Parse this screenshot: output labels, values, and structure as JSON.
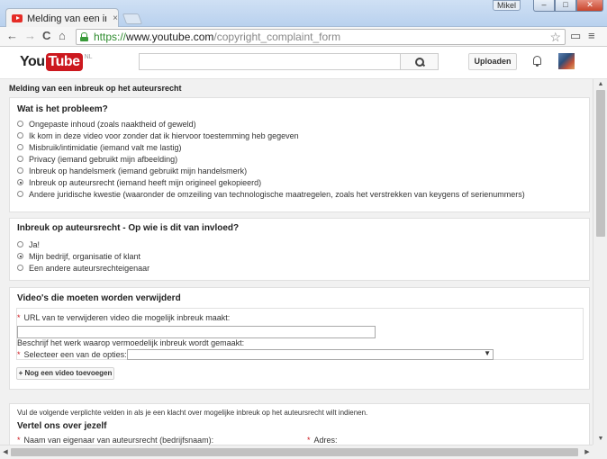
{
  "window": {
    "tab_title": "Melding van een inbreuk o",
    "tab_close": "×",
    "profile_name": "Mikel",
    "min_glyph": "–",
    "max_glyph": "□",
    "close_glyph": "✕"
  },
  "toolbar": {
    "back": "←",
    "forward": "→",
    "reload": "C",
    "home": "⌂",
    "url_scheme": "https://",
    "url_host": "www.youtube.com",
    "url_path": "/copyright_complaint_form",
    "star": "☆",
    "cast": "▭",
    "menu": "≡"
  },
  "yt_header": {
    "logo_you": "You",
    "logo_tube": "Tube",
    "logo_country": "NL",
    "search_value": "",
    "upload_label": "Uploaden"
  },
  "page": {
    "title": "Melding van een inbreuk op het auteursrecht"
  },
  "problem_card": {
    "title": "Wat is het probleem?",
    "options": [
      {
        "label": "Ongepaste inhoud (zoals naaktheid of geweld)",
        "checked": false
      },
      {
        "label": "Ik kom in deze video voor zonder dat ik hiervoor toestemming heb gegeven",
        "checked": false
      },
      {
        "label": "Misbruik/intimidatie (iemand valt me lastig)",
        "checked": false
      },
      {
        "label": "Privacy (iemand gebruikt mijn afbeelding)",
        "checked": false
      },
      {
        "label": "Inbreuk op handelsmerk (iemand gebruikt mijn handelsmerk)",
        "checked": false
      },
      {
        "label": "Inbreuk op auteursrecht (iemand heeft mijn origineel gekopieerd)",
        "checked": true
      },
      {
        "label": "Andere juridische kwestie (waaronder de omzeiling van technologische maatregelen, zoals het verstrekken van keygens of serienummers)",
        "checked": false
      }
    ]
  },
  "affected_card": {
    "title": "Inbreuk op auteursrecht - Op wie is dit van invloed?",
    "options": [
      {
        "label": "Ja!",
        "checked": false
      },
      {
        "label": "Mijn bedrijf, organisatie of klant",
        "checked": true
      },
      {
        "label": "Een andere auteursrechteigenaar",
        "checked": false
      }
    ]
  },
  "videos_card": {
    "title": "Video's die moeten worden verwijderd",
    "required_mark": "*",
    "url_label": "URL van te verwijderen video die mogelijk inbreuk maakt:",
    "url_value": "",
    "describe_label": "Beschrijf het werk waarop vermoedelijk inbreuk wordt gemaakt:",
    "select_label": "Selecteer een van de opties:",
    "select_value": "",
    "select_arrow": "▼",
    "add_video_label": "+ Nog een video toevoegen"
  },
  "about_card": {
    "note": "Vul de volgende verplichte velden in als je een klacht over mogelijke inbreuk op het auteursrecht wilt indienen.",
    "title": "Vertel ons over jezelf",
    "owner_label": "Naam van eigenaar van auteursrecht (bedrijfsnaam):",
    "address_label": "Adres:"
  },
  "scrollbars": {
    "up": "▲",
    "down": "▼",
    "left": "◀",
    "right": "▶"
  }
}
